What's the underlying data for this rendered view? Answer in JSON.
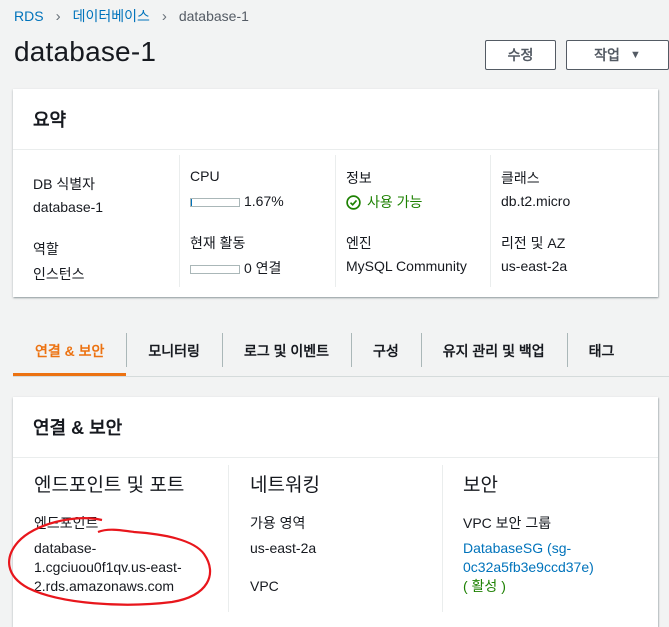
{
  "breadcrumb": {
    "rds": "RDS",
    "databases": "데이터베이스",
    "current": "database-1"
  },
  "page_title": "database-1",
  "buttons": {
    "edit": "수정",
    "actions": "작업"
  },
  "colors": {
    "link": "#0073bb",
    "accent": "#ec7211",
    "success": "#1d8102"
  },
  "summary": {
    "title": "요약",
    "db_id_label": "DB 식별자",
    "db_id": "database-1",
    "cpu_label": "CPU",
    "cpu_value": "1.67%",
    "cpu_fraction": 0.0167,
    "status_label": "정보",
    "status": "사용 가능",
    "class_label": "클래스",
    "class": "db.t2.micro",
    "role_label": "역할",
    "role": "인스턴스",
    "activity_label": "현재 활동",
    "activity": "0 연결",
    "activity_fraction": 0,
    "engine_label": "엔진",
    "engine": "MySQL Community",
    "region_label": "리전 및 AZ",
    "region": "us-east-2a"
  },
  "tabs": [
    "연결 & 보안",
    "모니터링",
    "로그 및 이벤트",
    "구성",
    "유지 관리 및 백업",
    "태그"
  ],
  "connectivity": {
    "title": "연결 & 보안",
    "endpoint_section": "엔드포인트 및 포트",
    "endpoint_label": "엔드포인트",
    "endpoint_lines": [
      "database-",
      "1.cgciuou0f1qv.us-east-",
      "2.rds.amazonaws.com"
    ],
    "network_section": "네트워킹",
    "az_label": "가용 영역",
    "az": "us-east-2a",
    "vpc_label": "VPC",
    "security_section": "보안",
    "sg_label": "VPC 보안 그룹",
    "sg_lines": [
      "DatabaseSG (sg-",
      "0c32a5fb3e9ccd37e)"
    ],
    "sg_status": "( 활성 )"
  }
}
